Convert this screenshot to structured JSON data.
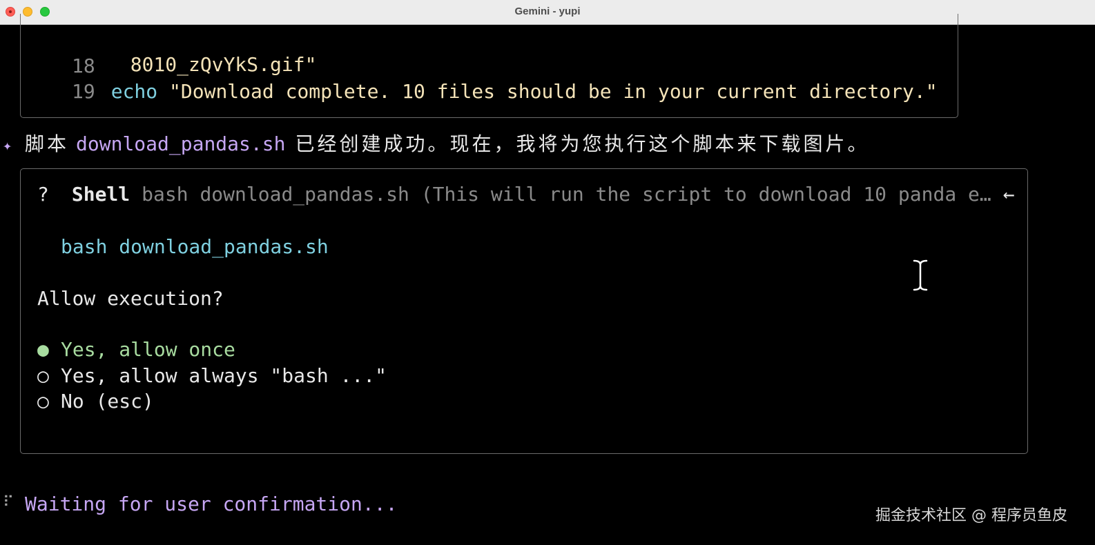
{
  "window": {
    "title": "Gemini - yupi"
  },
  "code_block": {
    "lines": [
      {
        "number": "",
        "segments": [
          {
            "text": "8010_zQvYkS.gif\"",
            "kind": "str"
          }
        ]
      },
      {
        "number": "18",
        "segments": []
      },
      {
        "number": "19",
        "segments": [
          {
            "text": "echo",
            "kind": "kw"
          },
          {
            "text": " \"Download complete. 10 files should be in your current directory.\"",
            "kind": "str"
          }
        ]
      }
    ]
  },
  "message": {
    "icon": "sparkle-icon",
    "prefix": "脚本",
    "filename": "download_pandas.sh",
    "suffix": "已经创建成功。现在，我将为您执行这个脚本来下载图片。"
  },
  "shell_prompt": {
    "question_mark": "?",
    "tool_name": "Shell",
    "description": "bash download_pandas.sh (This will run the script to download 10 panda e…",
    "back_arrow": "←",
    "command": "bash download_pandas.sh",
    "question": "Allow execution?",
    "options": [
      {
        "marker": "●",
        "label": "Yes, allow once",
        "selected": true
      },
      {
        "marker": "○",
        "label": "Yes, allow always \"bash ...\"",
        "selected": false
      },
      {
        "marker": "○",
        "label": "No (esc)",
        "selected": false
      }
    ]
  },
  "status": {
    "spinner": "⠏",
    "text": "Waiting for user confirmation..."
  },
  "watermark": "掘金技术社区 @ 程序员鱼皮",
  "colors": {
    "background": "#000000",
    "border": "#6b6b6b",
    "keyword": "#7fd0e0",
    "string": "#f4e3b8",
    "accent_purple": "#c6a6f3",
    "selected_green": "#a8dca0",
    "dim": "#8a8a8a"
  }
}
